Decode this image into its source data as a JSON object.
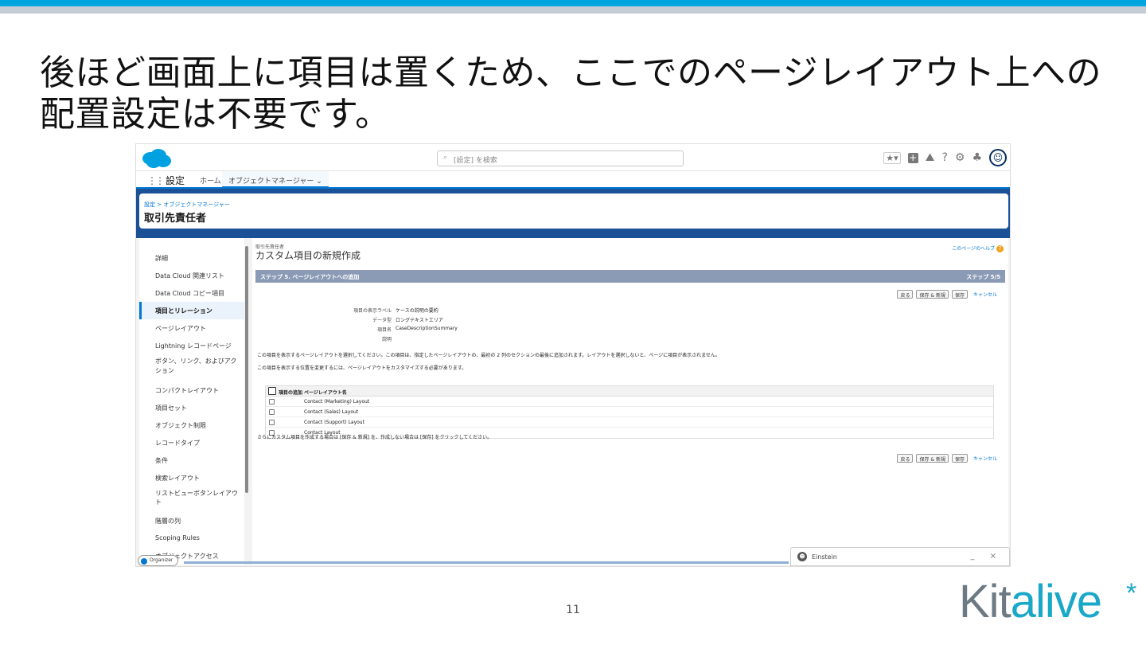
{
  "slide": {
    "title": "後ほど画面上に項目は置くため、ここでのページレイアウト上への配置設定は不要です。",
    "page_number": "11",
    "brand": {
      "part1": "Kit",
      "part2": "alive",
      "star": "*"
    }
  },
  "header": {
    "search_placeholder": "[設定] を検索",
    "search_icon": "search-icon"
  },
  "nav": {
    "app_name": "設定",
    "home": "ホーム",
    "object_manager": "オブジェクトマネージャー",
    "chevron": "⌄"
  },
  "record": {
    "breadcrumb": "設定 > オブジェクトマネージャー",
    "title": "取引先責任者"
  },
  "sidebar": {
    "items": [
      {
        "label": "詳細"
      },
      {
        "label": "Data Cloud 関連リスト"
      },
      {
        "label": "Data Cloud コピー項目"
      },
      {
        "label": "項目とリレーション"
      },
      {
        "label": "ページレイアウト"
      },
      {
        "label": "Lightning レコードページ"
      },
      {
        "label": "ボタン、リンク、およびアクション"
      },
      {
        "label": "コンパクトレイアウト"
      },
      {
        "label": "項目セット"
      },
      {
        "label": "オブジェクト制限"
      },
      {
        "label": "レコードタイプ"
      },
      {
        "label": "条件"
      },
      {
        "label": "検索レイアウト"
      },
      {
        "label": "リストビューボタンレイアウト"
      },
      {
        "label": "階層の列"
      },
      {
        "label": "Scoping Rules"
      },
      {
        "label": "オブジェクトアクセス"
      }
    ],
    "active_index": 3
  },
  "main": {
    "object_label": "取引先責任者",
    "page_heading": "カスタム項目の新規作成",
    "help_link": "このページのヘルプ",
    "step_title": "ステップ 5. ページレイアウトへの追加",
    "step_count": "ステップ 5/5",
    "buttons": {
      "back": "戻る",
      "save_new": "保存 & 新規",
      "save": "保存",
      "cancel": "キャンセル"
    },
    "fields": [
      {
        "label": "項目の表示ラベル",
        "value": "ケースの説明の要約"
      },
      {
        "label": "データ型",
        "value": "ロングテキストエリア"
      },
      {
        "label": "項目名",
        "value": "CaseDescriptionSummary"
      },
      {
        "label": "説明",
        "value": ""
      }
    ],
    "note1": "この項目を表示するページレイアウトを選択してください。この項目は、指定したページレイアウトの、最初の 2 列のセクションの最後に追加されます。レイアウトを選択しないと、ページに項目が表示されません。",
    "note2": "この項目を表示する位置を変更するには、ページレイアウトをカスタマイズする必要があります。",
    "table": {
      "headers": [
        "項目の追加",
        "ページレイアウト名"
      ],
      "rows": [
        "Contact (Marketing) Layout",
        "Contact (Sales) Layout",
        "Contact (Support) Layout",
        "Contact Layout"
      ]
    },
    "note3": "さらにカスタム項目を作成する場合は [保存 & 新規] を、作成しない場合は [保存] をクリックしてください。"
  },
  "einstein": {
    "label": "Einstein",
    "controls": "_ ×"
  },
  "organizer": {
    "label": "Organizer"
  }
}
